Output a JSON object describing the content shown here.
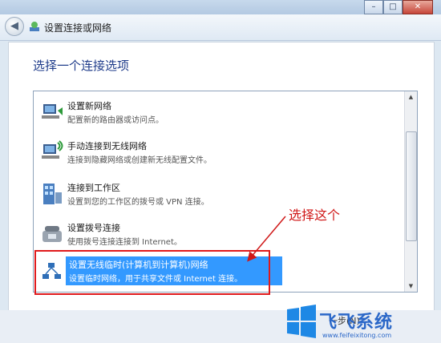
{
  "window": {
    "btn_min": "–",
    "btn_max": "□",
    "btn_close": "✕",
    "nav_title": "设置连接或网络"
  },
  "main": {
    "heading": "选择一个连接选项",
    "items": [
      {
        "icon": "network-icon",
        "title": "设置新网络",
        "desc": "配置新的路由器或访问点。"
      },
      {
        "icon": "wireless-network-icon",
        "title": "手动连接到无线网络",
        "desc": "连接到隐藏网络或创建新无线配置文件。"
      },
      {
        "icon": "workplace-icon",
        "title": "连接到工作区",
        "desc": "设置到您的工作区的拨号或 VPN 连接。"
      },
      {
        "icon": "dialup-phone-icon",
        "title": "设置拨号连接",
        "desc": "使用拨号连接连接到 Internet。"
      },
      {
        "icon": "adhoc-network-icon",
        "title": "设置无线临时(计算机到计算机)网络",
        "desc": "设置临时网络，用于共享文件或 Internet 连接。",
        "selected": true
      }
    ]
  },
  "annotation": {
    "text": "选择这个",
    "color": "#d01818"
  },
  "watermark": {
    "brand": "飞飞系统",
    "url": "www.feifeixitong.com",
    "partial_button": "一步(N)"
  },
  "colors": {
    "heading": "#1e3b8a",
    "selection": "#3399ff",
    "annotation_box": "#e0191c"
  }
}
